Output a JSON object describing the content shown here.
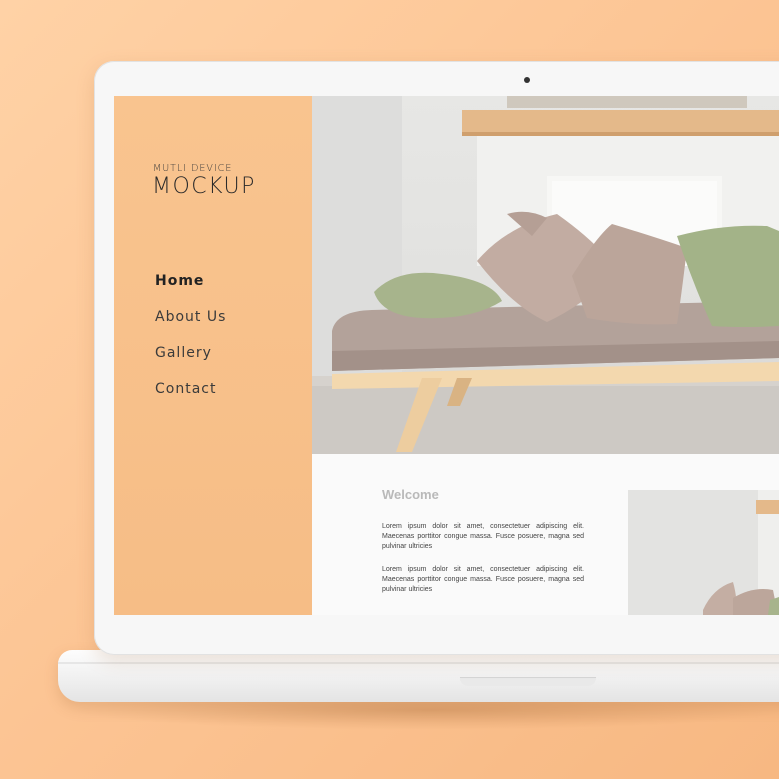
{
  "brand": {
    "subtitle": "MUTLI DEVICE",
    "title": "MOCKUP"
  },
  "nav": {
    "items": [
      {
        "label": "Home",
        "active": true
      },
      {
        "label": "About Us",
        "active": false
      },
      {
        "label": "Gallery",
        "active": false
      },
      {
        "label": "Contact",
        "active": false
      }
    ]
  },
  "content": {
    "heading": "Welcome",
    "paragraphs": [
      "Lorem ipsum dolor sit amet, consectetuer adipiscing elit. Maecenas porttitor congue massa. Fusce posuere, magna sed pulvinar ultricies",
      "Lorem ipsum dolor sit amet, consectetuer adipiscing elit. Maecenas porttitor congue massa. Fusce posuere, magna sed pulvinar ultricies"
    ]
  },
  "colors": {
    "background": "#fcc493",
    "sidebar": "#f8c28c",
    "laptop": "#f7f7f7"
  },
  "images": {
    "hero": "living-room-sofa-photo",
    "thumbnail": "interior-cushions-photo"
  }
}
